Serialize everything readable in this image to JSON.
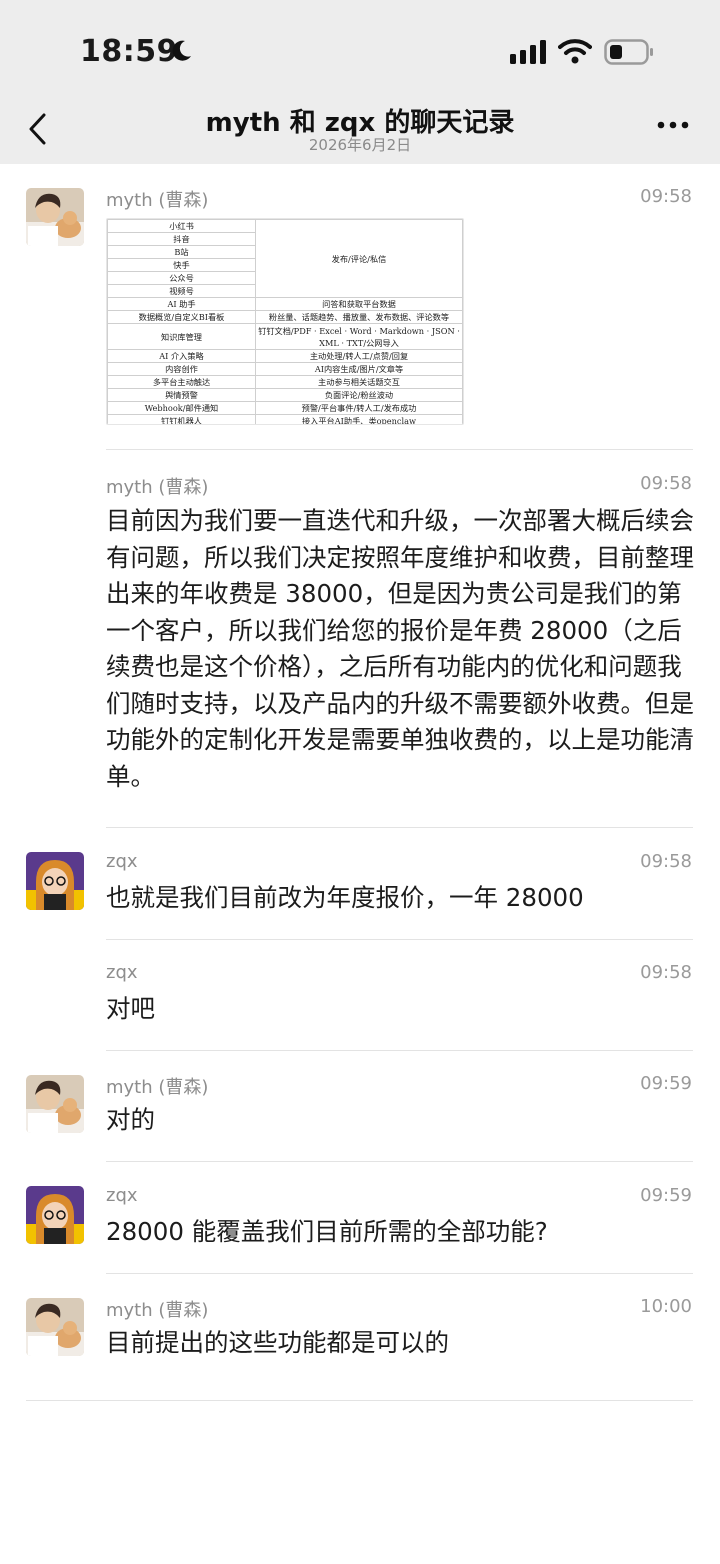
{
  "status_bar": {
    "time": "18:59"
  },
  "header": {
    "title": "myth 和 zqx 的聊天记录",
    "date": "2026年6月2日"
  },
  "icons": [
    "moon-icon",
    "signal-icon",
    "wifi-icon",
    "battery-icon",
    "back-arrow-icon",
    "more-icon"
  ],
  "feature_table": {
    "rows": [
      [
        "小红书",
        "发布/评论/私信"
      ],
      [
        "抖音",
        ""
      ],
      [
        "B站",
        ""
      ],
      [
        "快手",
        ""
      ],
      [
        "公众号",
        ""
      ],
      [
        "视频号",
        ""
      ],
      [
        "AI 助手",
        "问答和获取平台数据"
      ],
      [
        "数据概览/自定义BI看板",
        "粉丝量、话题趋势、播放量、发布数据、评论数等"
      ],
      [
        "知识库管理",
        "钉钉文档/PDF · Excel · Word · Markdown · JSON · XML · TXT/公网导入"
      ],
      [
        "AI 介入策略",
        "主动处理/转人工/点赞/回复"
      ],
      [
        "内容创作",
        "AI内容生成/图片/文章等"
      ],
      [
        "多平台主动触达",
        "主动参与相关话题交互"
      ],
      [
        "舆情预警",
        "负面评论/粉丝波动"
      ],
      [
        "Webhook/邮件通知",
        "预警/平台事件/转人工/发布成功"
      ],
      [
        "钉钉机器人",
        "接入平台AI助手、类openclaw"
      ]
    ]
  },
  "messages": [
    {
      "sender": "myth (曹森)",
      "time": "09:58",
      "type": "image"
    },
    {
      "sender": "myth (曹森)",
      "time": "09:58",
      "text": "目前因为我们要一直迭代和升级，一次部署大概后续会有问题，所以我们决定按照年度维护和收费，目前整理出来的年收费是 38000，但是因为贵公司是我们的第一个客户，所以我们给您的报价是年费 28000（之后续费也是这个价格），之后所有功能内的优化和问题我们随时支持，以及产品内的升级不需要额外收费。但是功能外的定制化开发是需要单独收费的，以上是功能清单。"
    },
    {
      "sender": "zqx",
      "time": "09:58",
      "text": "也就是我们目前改为年度报价，一年 28000"
    },
    {
      "sender": "zqx",
      "time": "09:58",
      "text": "对吧"
    },
    {
      "sender": "myth (曹森)",
      "time": "09:59",
      "text": "对的"
    },
    {
      "sender": "zqx",
      "time": "09:59",
      "text": "28000 能覆盖我们目前所需的全部功能?"
    },
    {
      "sender": "myth (曹森)",
      "time": "10:00",
      "text": "目前提出的这些功能都是可以的"
    }
  ]
}
